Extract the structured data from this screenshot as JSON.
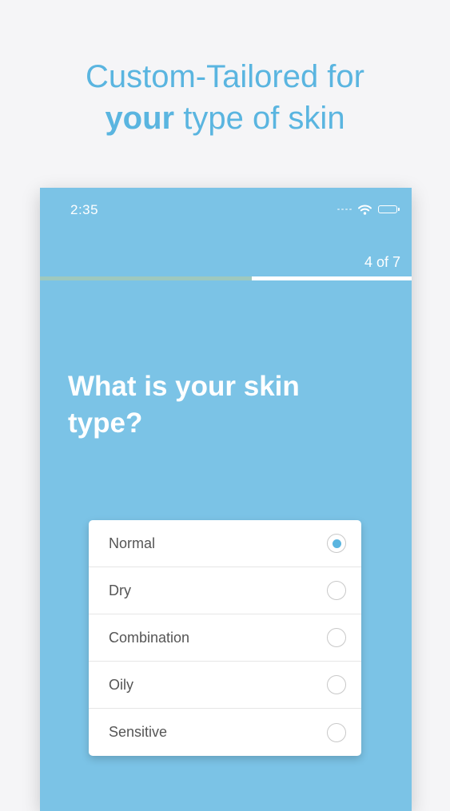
{
  "headline": {
    "line1": "Custom-Tailored for",
    "line2_bold": "your",
    "line2_rest": " type of skin"
  },
  "status_bar": {
    "time": "2:35",
    "icons": [
      "cellular-signal-icon",
      "wifi-icon",
      "battery-icon"
    ]
  },
  "progress": {
    "text": "4 of 7",
    "current": 4,
    "total": 7,
    "fraction": 0.57
  },
  "question": "What is your skin type?",
  "options": [
    {
      "label": "Normal",
      "selected": true
    },
    {
      "label": "Dry",
      "selected": false
    },
    {
      "label": "Combination",
      "selected": false
    },
    {
      "label": "Oily",
      "selected": false
    },
    {
      "label": "Sensitive",
      "selected": false
    }
  ],
  "colors": {
    "accent": "#5ab5e0",
    "screen_background": "#7bc3e6",
    "progress_fill": "#9ec9be",
    "page_background": "#f5f5f7"
  }
}
